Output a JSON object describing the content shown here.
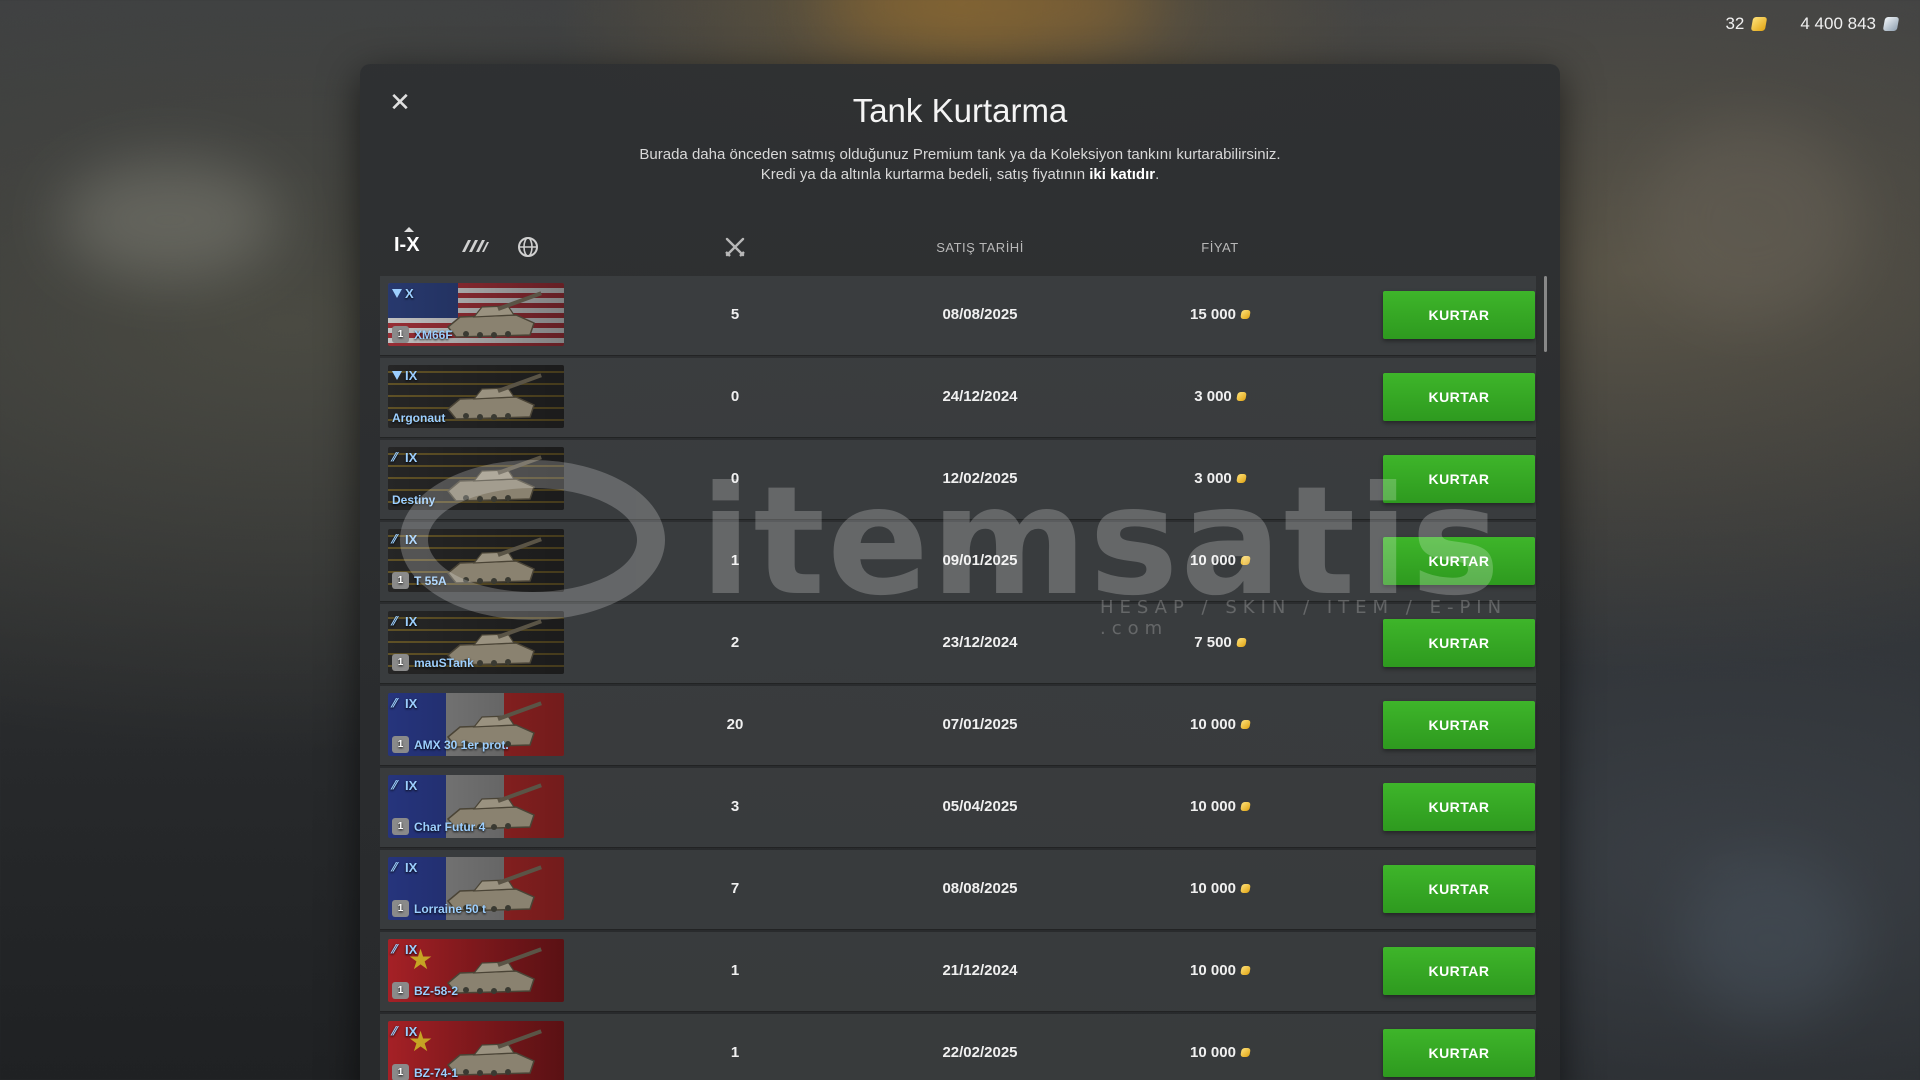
{
  "currencies": {
    "gold": "32",
    "silver": "4 400 843"
  },
  "modal": {
    "title": "Tank Kurtarma",
    "desc_line1": "Burada daha önceden satmış olduğunuz Premium tank ya da Koleksiyon tankını kurtarabilirsiniz.",
    "desc_line2_prefix": "Kredi ya da altınla kurtarma bedeli, satış fiyatının ",
    "desc_line2_bold": "iki katıdır",
    "desc_line2_suffix": "."
  },
  "header": {
    "tier_filter": "I-X",
    "date_label": "SATIŞ TARİHİ",
    "price_label": "FİYAT"
  },
  "rows": [
    {
      "tier": "X",
      "type": "premium",
      "flag": "usa",
      "name": "XM66F",
      "crew": "1",
      "battles": "5",
      "date": "08/08/2025",
      "price": "15 000",
      "button": "KURTAR"
    },
    {
      "tier": "IX",
      "type": "premium",
      "flag": "stripes",
      "name": "Argonaut",
      "crew": "",
      "battles": "0",
      "date": "24/12/2024",
      "price": "3 000",
      "button": "KURTAR"
    },
    {
      "tier": "IX",
      "type": "collector",
      "flag": "stripes",
      "name": "Destiny",
      "crew": "",
      "battles": "0",
      "date": "12/02/2025",
      "price": "3 000",
      "button": "KURTAR"
    },
    {
      "tier": "IX",
      "type": "collector",
      "flag": "stripes",
      "name": "T 55A",
      "crew": "1",
      "battles": "1",
      "date": "09/01/2025",
      "price": "10 000",
      "button": "KURTAR"
    },
    {
      "tier": "IX",
      "type": "collector",
      "flag": "stripes",
      "name": "mauSTank",
      "crew": "1",
      "battles": "2",
      "date": "23/12/2024",
      "price": "7 500",
      "button": "KURTAR"
    },
    {
      "tier": "IX",
      "type": "collector",
      "flag": "fr",
      "name": "AMX 30 1er prot.",
      "crew": "1",
      "battles": "20",
      "date": "07/01/2025",
      "price": "10 000",
      "button": "KURTAR"
    },
    {
      "tier": "IX",
      "type": "collector",
      "flag": "fr",
      "name": "Char Futur 4",
      "crew": "1",
      "battles": "3",
      "date": "05/04/2025",
      "price": "10 000",
      "button": "KURTAR"
    },
    {
      "tier": "IX",
      "type": "collector",
      "flag": "fr",
      "name": "Lorraine 50 t",
      "crew": "1",
      "battles": "7",
      "date": "08/08/2025",
      "price": "10 000",
      "button": "KURTAR"
    },
    {
      "tier": "IX",
      "type": "collector",
      "flag": "cn",
      "name": "BZ-58-2",
      "crew": "1",
      "battles": "1",
      "date": "21/12/2024",
      "price": "10 000",
      "button": "KURTAR"
    },
    {
      "tier": "IX",
      "type": "collector",
      "flag": "cn",
      "name": "BZ-74-1",
      "crew": "1",
      "battles": "1",
      "date": "22/02/2025",
      "price": "10 000",
      "button": "KURTAR"
    }
  ],
  "watermark": {
    "text": "itemsatis",
    "sub": "HESAP / SKIN / ITEM / E-PIN .com"
  },
  "colors": {
    "button_green": "#3eb52a",
    "tank_name_blue": "#9ccfff",
    "gold": "#e0a414"
  }
}
